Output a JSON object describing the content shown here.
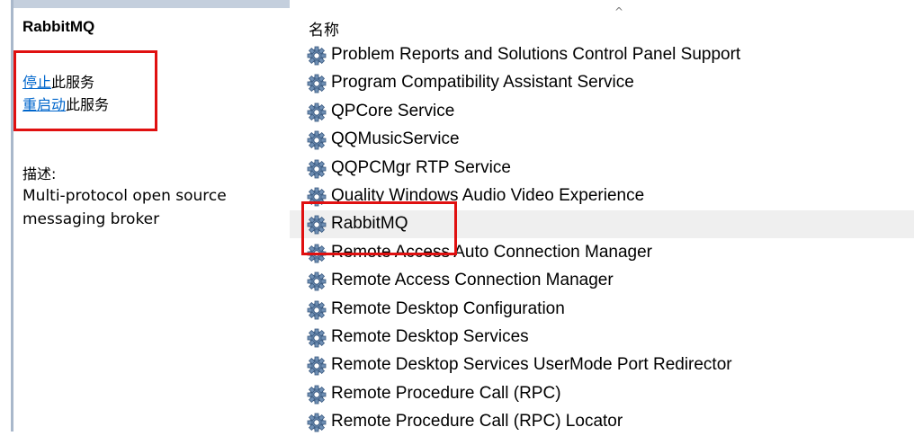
{
  "details": {
    "service_name": "RabbitMQ",
    "actions": [
      {
        "link": "停止",
        "suffix": "此服务"
      },
      {
        "link": "重启动",
        "suffix": "此服务"
      }
    ],
    "description_label": "描述:",
    "description": "Multi-protocol open source messaging broker"
  },
  "list": {
    "column_header": "名称",
    "sort_indicator": "^",
    "selected_index": 6,
    "rows": [
      "Problem Reports and Solutions Control Panel Support",
      "Program Compatibility Assistant Service",
      "QPCore Service",
      "QQMusicService",
      "QQPCMgr RTP Service",
      "Quality Windows Audio Video Experience",
      "RabbitMQ",
      "Remote Access Auto Connection Manager",
      "Remote Access Connection Manager",
      "Remote Desktop Configuration",
      "Remote Desktop Services",
      "Remote Desktop Services UserMode Port Redirector",
      "Remote Procedure Call (RPC)",
      "Remote Procedure Call (RPC) Locator"
    ],
    "row_icon": "gear-icon"
  },
  "colors": {
    "accent_link": "#0066cc",
    "highlight_box": "#e01010",
    "selected_row": "#efefef"
  }
}
